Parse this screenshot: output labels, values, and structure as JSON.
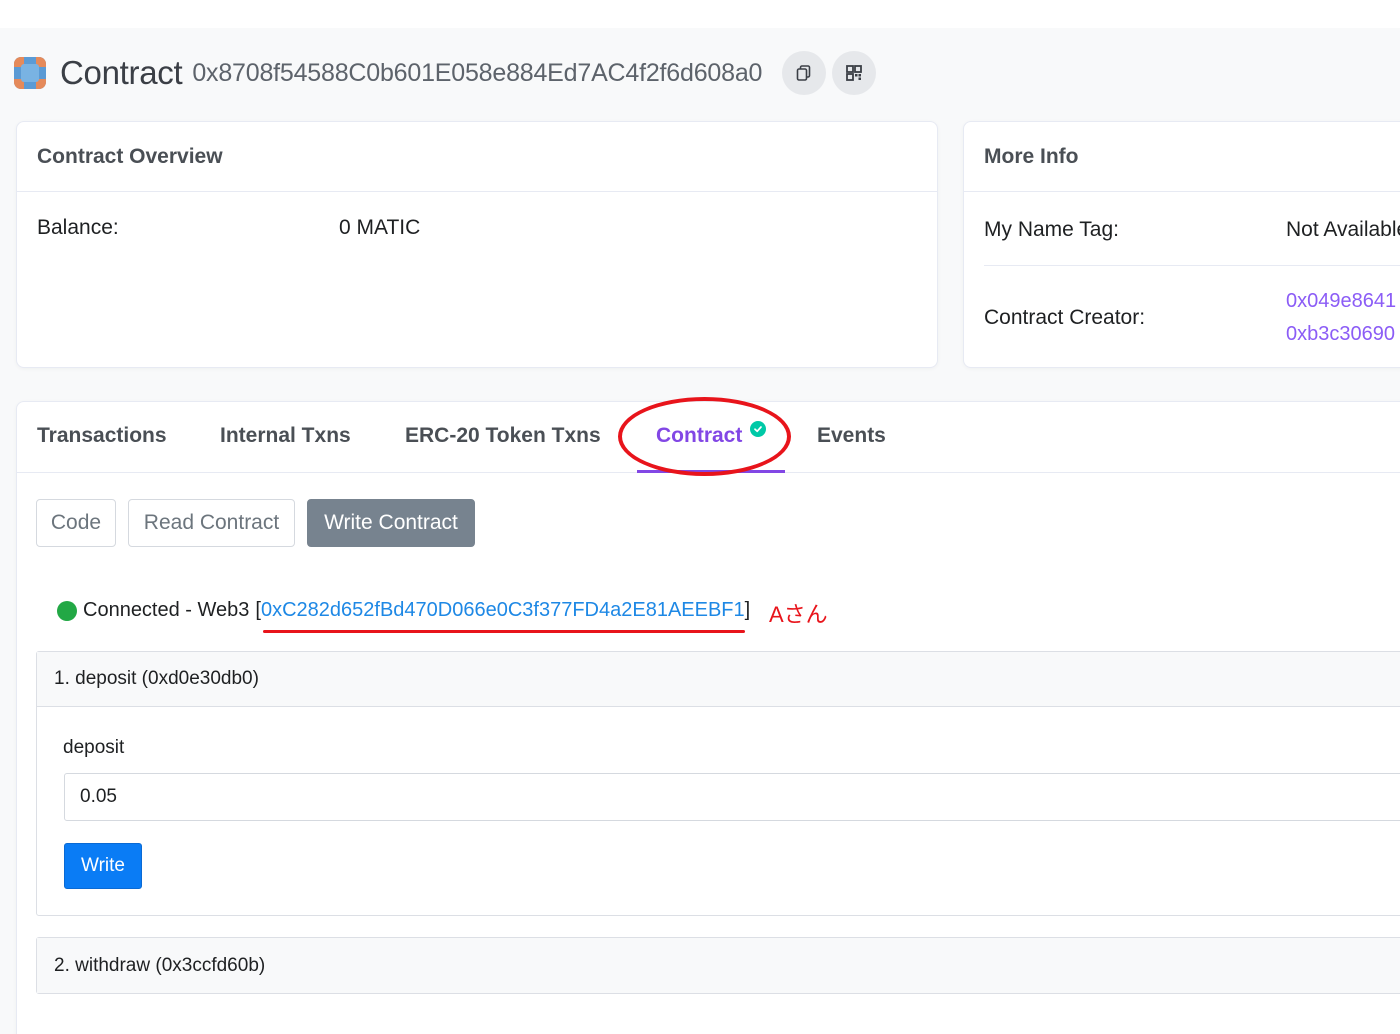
{
  "header": {
    "title": "Contract",
    "address": "0x8708f54588C0b601E058e884Ed7AC4f2f6d608a0",
    "copy_icon": "copy-icon",
    "qr_icon": "qr-code-icon"
  },
  "overview": {
    "title": "Contract Overview",
    "balance_label": "Balance:",
    "balance_value": "0 MATIC"
  },
  "more_info": {
    "title": "More Info",
    "name_tag_label": "My Name Tag:",
    "name_tag_value": "Not Available",
    "creator_label": "Contract Creator:",
    "creator_address": "0x049e8641",
    "creator_txn": "0xb3c30690"
  },
  "tabs": [
    {
      "label": "Transactions"
    },
    {
      "label": "Internal Txns"
    },
    {
      "label": "ERC-20 Token Txns"
    },
    {
      "label": "Contract",
      "active": true,
      "verified": true
    },
    {
      "label": "Events"
    }
  ],
  "subtabs": [
    {
      "label": "Code"
    },
    {
      "label": "Read Contract"
    },
    {
      "label": "Write Contract",
      "active": true
    }
  ],
  "connection": {
    "status": "Connected - Web3",
    "bracket_open": "[",
    "account": "0xC282d652fBd470D066e0C3f377FD4a2E81AEEBF1",
    "bracket_close": "]",
    "annotation": "Aさん"
  },
  "functions": [
    {
      "title": "1. deposit (0xd0e30db0)",
      "input_label": "deposit",
      "input_value": "0.05",
      "button_label": "Write"
    },
    {
      "title": "2. withdraw (0x3ccfd60b)"
    }
  ],
  "colors": {
    "accent": "#8247e5",
    "link": "#1e88e5",
    "annotation": "#e8141b",
    "primary_button": "#0a7cf5",
    "connected_dot": "#22a845",
    "verified": "#00c9a7"
  }
}
